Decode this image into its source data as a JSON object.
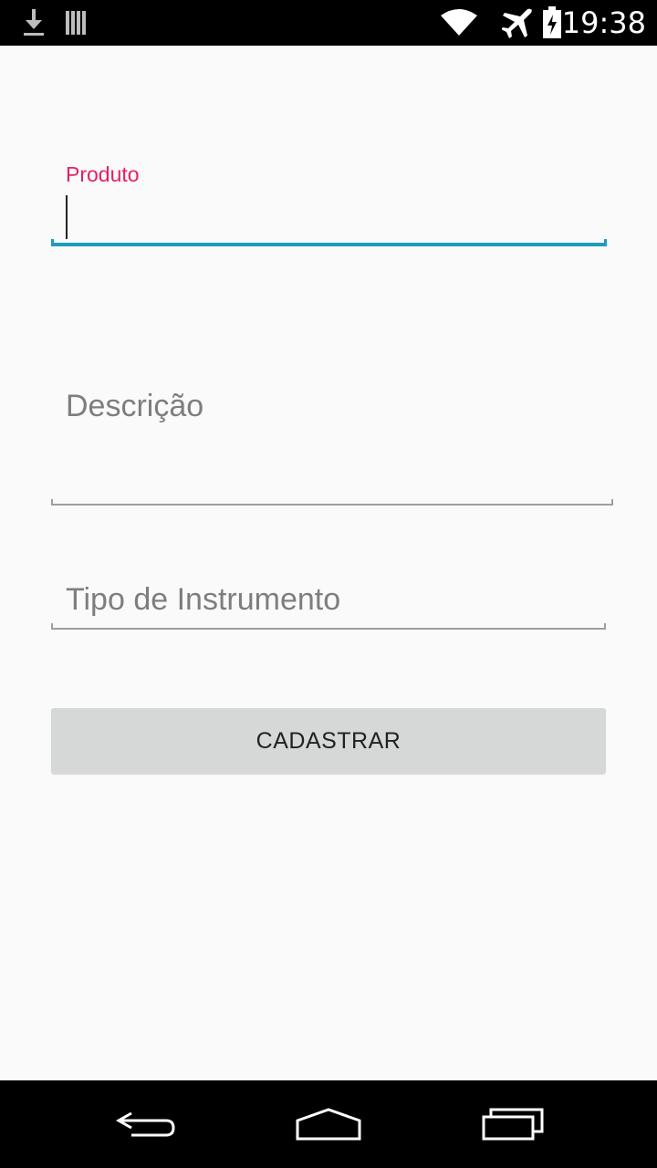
{
  "status_bar": {
    "time": "19:38",
    "icons": [
      "download-icon",
      "storage-icon",
      "wifi-icon",
      "airplane-mode-icon",
      "battery-charging-icon"
    ]
  },
  "form": {
    "produto": {
      "label": "Produto",
      "value": ""
    },
    "descricao": {
      "placeholder": "Descrição"
    },
    "tipo": {
      "placeholder": "Tipo de Instrumento"
    },
    "submit_label": "CADASTRAR"
  },
  "nav_bar": {
    "icons": [
      "back-icon",
      "home-icon",
      "recents-icon"
    ]
  },
  "colors": {
    "accent_label": "#e91e63",
    "accent_underline": "#1e9bbf",
    "button_bg": "#d6d7d7"
  }
}
